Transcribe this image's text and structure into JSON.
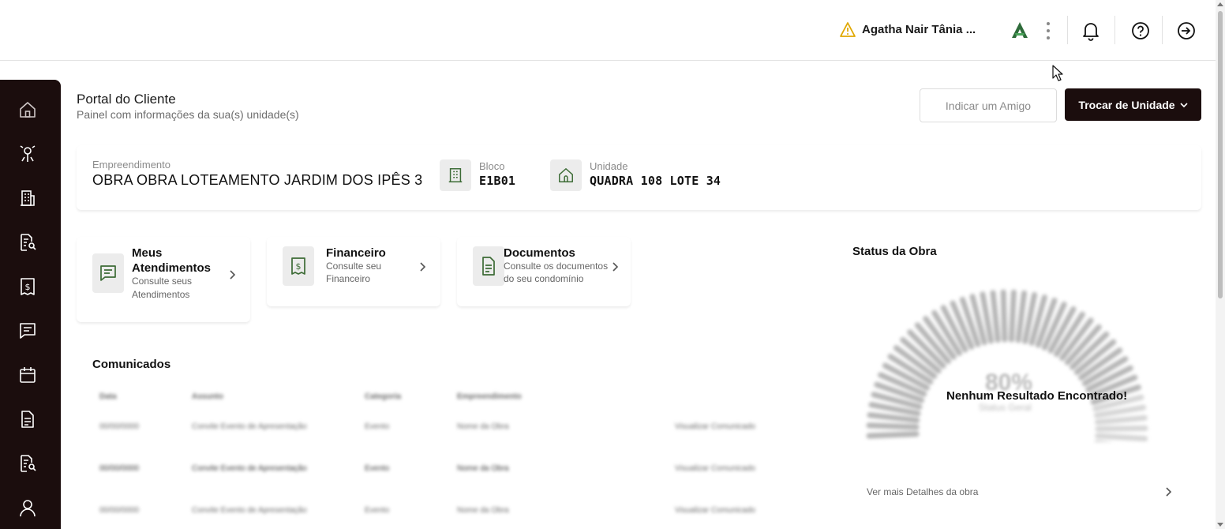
{
  "header": {
    "user_name": "Agatha Nair Tânia ...",
    "icons": [
      "warning-icon",
      "brand-logo",
      "kebab-menu-icon",
      "bell-icon",
      "help-icon",
      "logout-icon"
    ]
  },
  "sidebar": {
    "items": [
      {
        "name": "home",
        "icon": "home-icon"
      },
      {
        "name": "tools",
        "icon": "tools-icon"
      },
      {
        "name": "building",
        "icon": "building-icon"
      },
      {
        "name": "document-search",
        "icon": "document-search-icon"
      },
      {
        "name": "finance",
        "icon": "receipt-dollar-icon"
      },
      {
        "name": "messages",
        "icon": "chat-icon"
      },
      {
        "name": "calendar",
        "icon": "calendar-icon"
      },
      {
        "name": "documents",
        "icon": "document-icon"
      },
      {
        "name": "document-search-2",
        "icon": "document-search-icon"
      },
      {
        "name": "profile",
        "icon": "user-icon"
      }
    ]
  },
  "page": {
    "title": "Portal do Cliente",
    "subtitle": "Painel com informações da sua(s) unidade(s)",
    "refer_button": "Indicar um Amigo",
    "switch_unit_button": "Trocar de Unidade"
  },
  "unit_info": {
    "empreendimento_label": "Empreendimento",
    "empreendimento_value": "OBRA OBRA LOTEAMENTO JARDIM DOS IPÊS 3",
    "bloco_label": "Bloco",
    "bloco_value": "E1B01",
    "unidade_label": "Unidade",
    "unidade_value": "QUADRA 108 LOTE 34"
  },
  "quick_links": [
    {
      "title": "Meus Atendimentos",
      "title_line1": "Meus",
      "title_line2": "Atendimentos",
      "desc_line1": "Consulte seus",
      "desc_line2": "Atendimentos"
    },
    {
      "title": "Financeiro",
      "desc_line1": "Consulte seu",
      "desc_line2": "Financeiro"
    },
    {
      "title": "Documentos",
      "desc_line1": "Consulte os documentos",
      "desc_line2": "do seu condomínio"
    }
  ],
  "comunicados": {
    "title": "Comunicados",
    "headers": [
      "Data",
      "Assunto",
      "Categoria",
      "Empreendimento"
    ],
    "rows": [
      [
        "00/00/0000",
        "Convite Evento de Apresentação",
        "Evento",
        "Nome da Obra",
        "Visualizar Comunicado"
      ],
      [
        "00/00/0000",
        "Convite Evento de Apresentação",
        "Evento",
        "Nome da Obra",
        "Visualizar Comunicado"
      ],
      [
        "00/00/0000",
        "Convite Evento de Apresentação",
        "Evento",
        "Nome da Obra",
        "Visualizar Comunicado"
      ]
    ]
  },
  "status": {
    "title": "Status da Obra",
    "percent_text": "80%",
    "sub_text": "Status Geral",
    "no_result": "Nenhum Resultado Encontrado!",
    "more_link": "Ver mais Detalhes da obra"
  },
  "colors": {
    "dark": "#1b0d0d",
    "accent_green": "#2e6b3a",
    "warning": "#e0a800"
  }
}
